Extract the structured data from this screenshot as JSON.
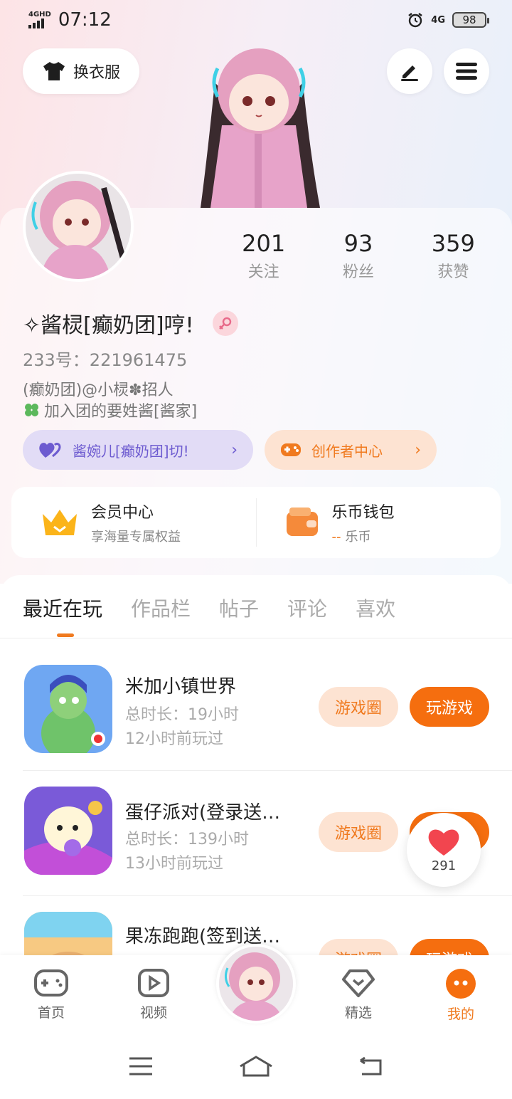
{
  "status_bar": {
    "network": "4GHD",
    "time": "07:12",
    "mobile_data": "4G",
    "battery": "98"
  },
  "header": {
    "outfit_label": "换衣服"
  },
  "stats": [
    {
      "value": "201",
      "label": "关注"
    },
    {
      "value": "93",
      "label": "粉丝"
    },
    {
      "value": "359",
      "label": "获赞"
    }
  ],
  "profile": {
    "username": "✧酱棂[癫奶团]哼!",
    "uid": "233号：221961475",
    "bio_line1": "(癫奶团)@小棂✽招人",
    "bio_line2": "加入团的要姓酱[酱家]"
  },
  "pills": {
    "group_label": "酱婉儿[癫奶团]切!",
    "creator_label": "创作者中心"
  },
  "member": {
    "vip_title": "会员中心",
    "vip_sub": "享海量专属权益",
    "wallet_title": "乐币钱包",
    "wallet_value": "--",
    "wallet_unit": "乐币"
  },
  "tabs": [
    "最近在玩",
    "作品栏",
    "帖子",
    "评论",
    "喜欢"
  ],
  "games": [
    {
      "name": "米加小镇世界",
      "duration": "总时长：19小时",
      "last_played": "12小时前玩过",
      "circle_label": "游戏圈",
      "play_label": "玩游戏"
    },
    {
      "name": "蛋仔派对(登录送…",
      "duration": "总时长：139小时",
      "last_played": "13小时前玩过",
      "circle_label": "游戏圈",
      "play_label": "玩游戏"
    },
    {
      "name": "果冻跑跑(签到送…",
      "duration": "",
      "last_played": "",
      "circle_label": "游戏圈",
      "play_label": "玩游戏"
    }
  ],
  "like_float": {
    "count": "291"
  },
  "bottom_nav": [
    {
      "label": "首页",
      "icon": "gamepad-icon"
    },
    {
      "label": "视频",
      "icon": "video-play-icon"
    },
    {
      "label": "精选",
      "icon": "heart-diamond-icon"
    },
    {
      "label": "我的",
      "icon": "profile-face-icon"
    }
  ],
  "colors": {
    "accent": "#f56e0f",
    "accent_soft": "#fde3d2",
    "purple": "#6d5bd0",
    "purple_soft": "#e2dcf6"
  }
}
